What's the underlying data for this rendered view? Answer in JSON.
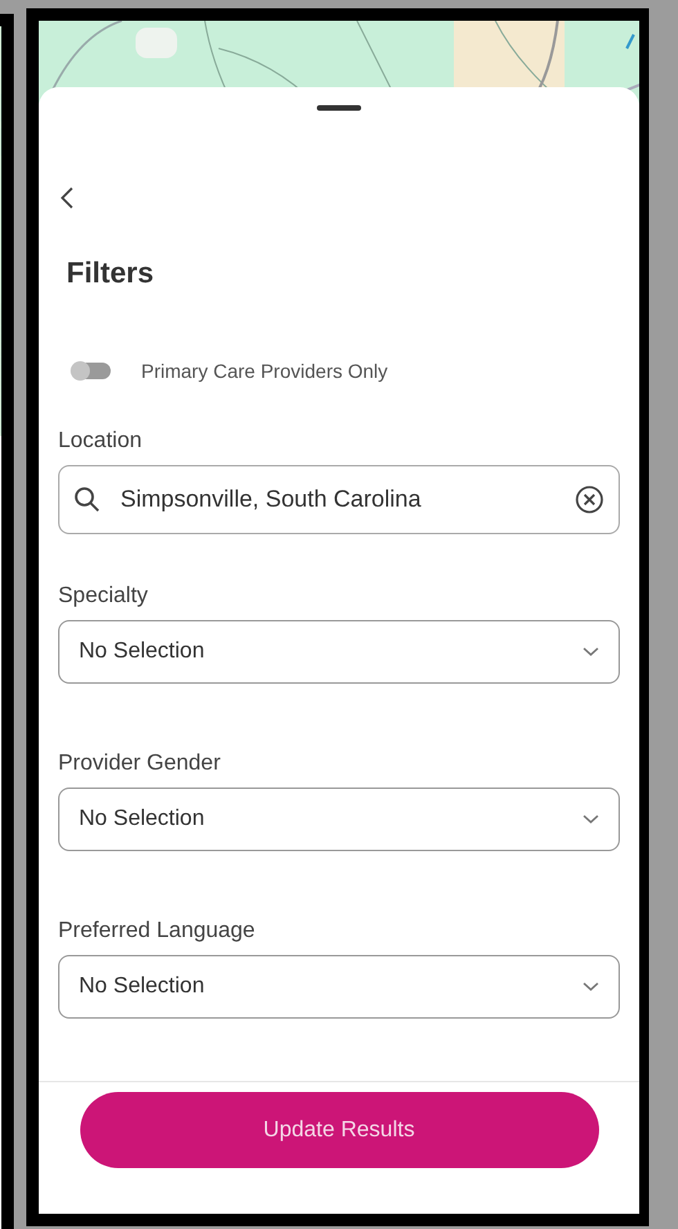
{
  "title": "Filters",
  "toggle": {
    "label": "Primary Care Providers Only",
    "on": false
  },
  "location": {
    "label": "Location",
    "value": "Simpsonville, South Carolina"
  },
  "dropdowns": [
    {
      "label": "Specialty",
      "value": "No Selection"
    },
    {
      "label": "Provider Gender",
      "value": "No Selection"
    },
    {
      "label": "Preferred Language",
      "value": "No Selection"
    }
  ],
  "button": "Update Results"
}
